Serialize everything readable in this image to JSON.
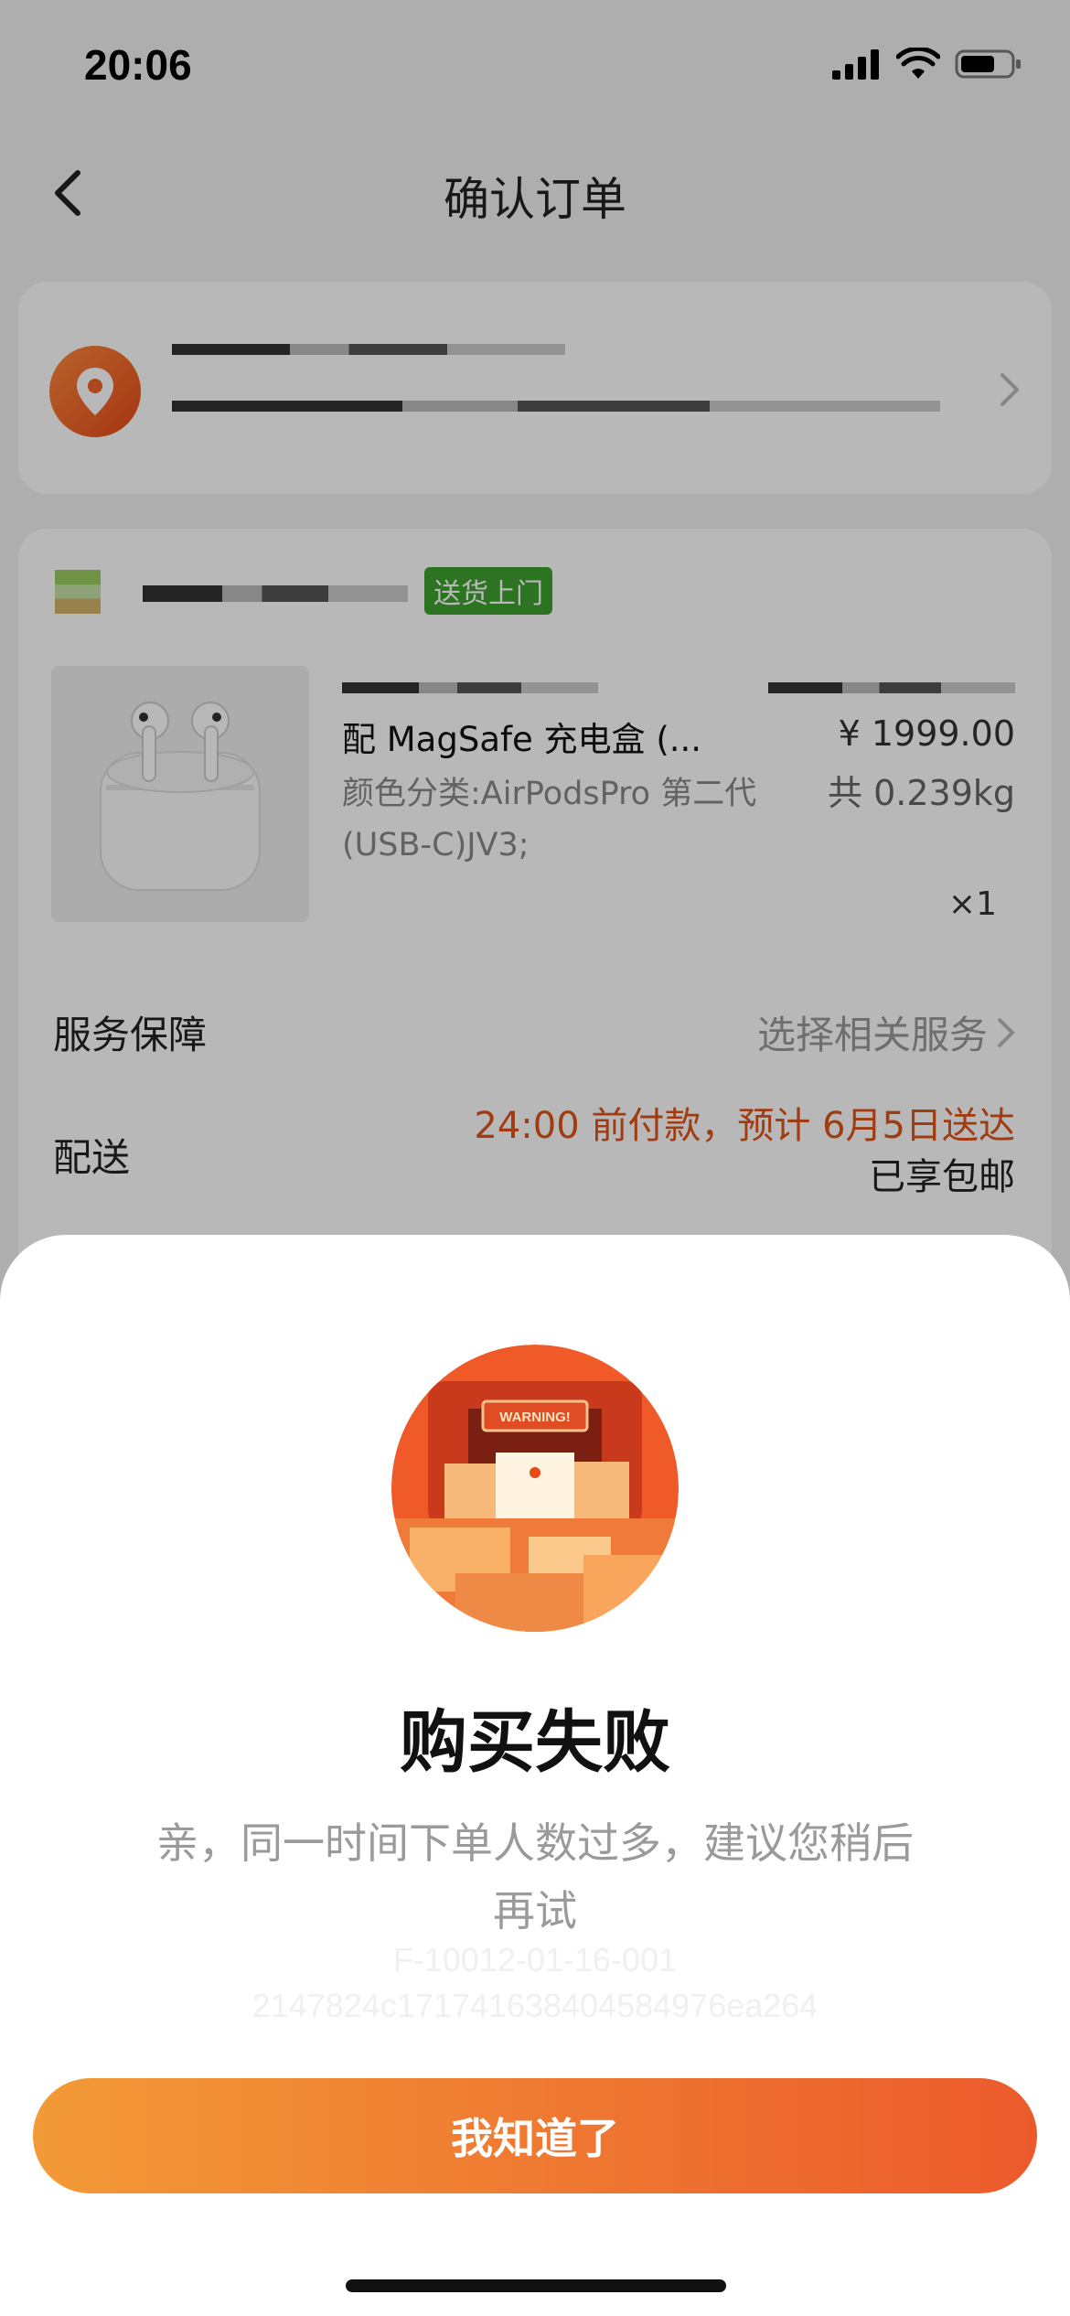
{
  "status_bar": {
    "time": "20:06",
    "icons": [
      "signal-icon",
      "wifi-icon",
      "battery-icon"
    ]
  },
  "header": {
    "title": "确认订单",
    "back_icon": "chevron-left-icon"
  },
  "address": {
    "icon": "location-pin-icon",
    "chevron": "chevron-right-icon"
  },
  "shop": {
    "delivery_tag": "送货上门"
  },
  "product": {
    "title": "配 MagSafe 充电盒 (...",
    "spec": "颜色分类:AirPodsPro 第二代 (USB-C)JV3;",
    "price": "¥ 1999.00",
    "weight": "共 0.239kg",
    "quantity": "×1"
  },
  "service": {
    "label": "服务保障",
    "value": "选择相关服务"
  },
  "shipping": {
    "label": "配送",
    "eta": "24:00 前付款，预计 6月5日送达",
    "note": "已享包邮"
  },
  "dialog": {
    "title": "购买失败",
    "message": "亲，同一时间下单人数过多，建议您稍后再试",
    "code1": "F-10012-01-16-001",
    "code2": "2147824c1717416384045849​76ea264",
    "button": "我知道了"
  },
  "colors": {
    "accent": "#ec5a2c",
    "accent_start": "#f29a37",
    "tag_green": "#3da130",
    "warning_text": "#e0531a"
  }
}
